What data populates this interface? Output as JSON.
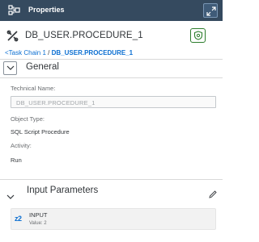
{
  "header": {
    "title": "Properties",
    "app_icon": "task-chain-icon",
    "expand_icon": "expand-icon"
  },
  "object": {
    "title": "DB_USER.PROCEDURE_1",
    "icon": "procedure-icon",
    "badge_icon": "shield-status-icon",
    "badge_color": "#2b7c2b"
  },
  "breadcrumb": {
    "parent": "<Task Chain 1",
    "separator": "/",
    "current": "DB_USER.PROCEDURE_1"
  },
  "general": {
    "title": "General",
    "technical_name_label": "Technical Name:",
    "technical_name_value": "DB_USER.PROCEDURE_1",
    "object_type_label": "Object Type:",
    "object_type_value": "SQL Script Procedure",
    "activity_label": "Activity:",
    "activity_value": "Run"
  },
  "input_parameters": {
    "title": "Input Parameters",
    "edit_icon": "pencil-icon",
    "items": [
      {
        "type_icon": "z2",
        "name": "INPUT",
        "value": "Value: 2"
      }
    ]
  },
  "colors": {
    "header_bg": "#354a5f",
    "link": "#0a6ed1",
    "text": "#32363a"
  }
}
